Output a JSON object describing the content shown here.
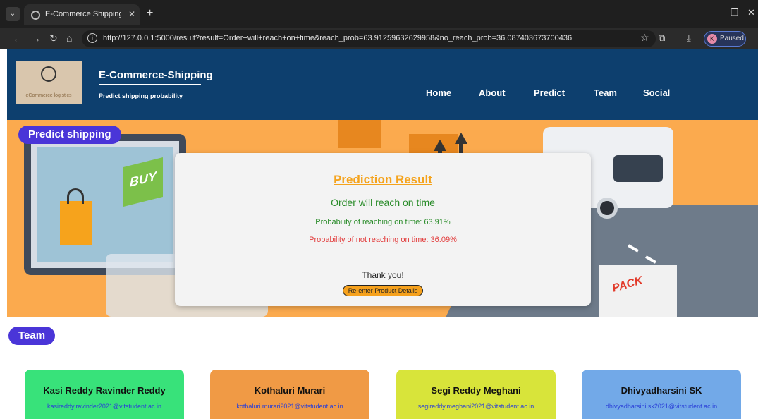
{
  "browser": {
    "tab_title": "E-Commerce Shipping Predicti",
    "url": "http://127.0.0.1:5000/result?result=Order+will+reach+on+time&reach_prob=63.91259632629958&no_reach_prob=36.087403673700436",
    "profile_initial": "K",
    "profile_status": "Paused"
  },
  "header": {
    "logo_text": "eCommerce logistics",
    "brand": "E-Commerce-Shipping",
    "tagline": "Predict shipping probability",
    "nav": [
      "Home",
      "About",
      "Predict",
      "Team",
      "Social"
    ]
  },
  "hero": {
    "section_label": "Predict shipping",
    "buy_text": "BUY",
    "pack_text": "PACK"
  },
  "result": {
    "title": "Prediction Result",
    "status": "Order will reach on time",
    "reach_text": "Probability of reaching on time: 63.91%",
    "no_reach_text": "Probability of not reaching on time: 36.09%",
    "thanks": "Thank you!",
    "reenter_button": "Re-enter Product Details"
  },
  "team": {
    "section_label": "Team",
    "members": [
      {
        "name": "Kasi Reddy Ravinder Reddy",
        "email": "kasireddy.ravinder2021@vitstudent.ac.in",
        "color": "#38e27a"
      },
      {
        "name": "Kothaluri Murari",
        "email": "kothaluri.murari2021@vitstudent.ac.in",
        "color": "#f09a45"
      },
      {
        "name": "Segi Reddy Meghani",
        "email": "segireddy.meghani2021@vitstudent.ac.in",
        "color": "#d8e43a"
      },
      {
        "name": "Dhivyadharsini SK",
        "email": "dhivyadharsini.sk2021@vitstudent.ac.in",
        "color": "#72a9e8"
      }
    ]
  }
}
